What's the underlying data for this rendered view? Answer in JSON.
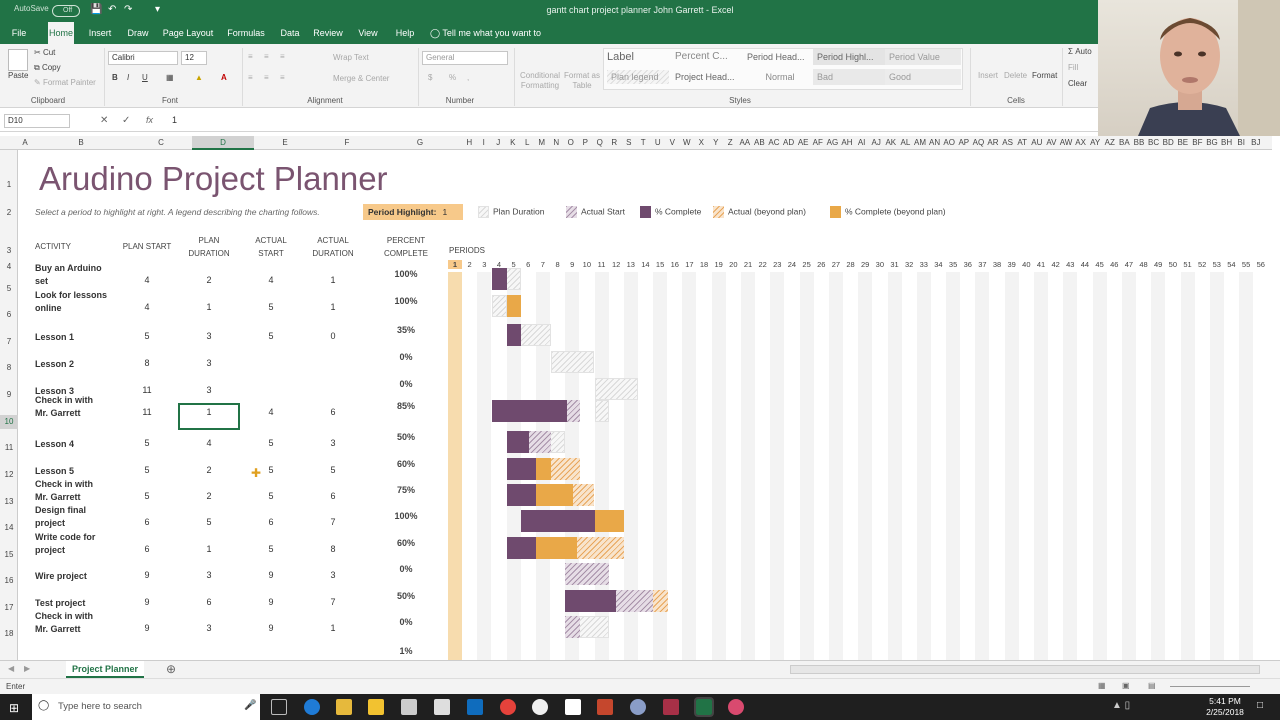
{
  "window": {
    "title": "gantt chart project planner John Garrett - Excel",
    "autosave_label": "AutoSave",
    "autosave_state": "Off"
  },
  "ribbon_tabs": [
    "File",
    "Home",
    "Insert",
    "Draw",
    "Page Layout",
    "Formulas",
    "Data",
    "Review",
    "View",
    "Help"
  ],
  "active_tab": "Home",
  "tell_me": "Tell me what you want to do",
  "ribbon": {
    "cut": "Cut",
    "copy": "Copy",
    "format_painter": "Format Painter",
    "paste": "Paste",
    "font_name": "Calibri",
    "font_size": "12",
    "wrap_text": "Wrap Text",
    "merge_center": "Merge & Center",
    "number_format": "General",
    "conditional_formatting": "Conditional Formatting",
    "format_as_table": "Format as Table",
    "insert": "Insert",
    "delete": "Delete",
    "format": "Format",
    "autosum": "Auto",
    "fill": "Fill",
    "clear": "Clear",
    "groups": {
      "clipboard": "Clipboard",
      "font": "Font",
      "alignment": "Alignment",
      "number": "Number",
      "styles": "Styles",
      "cells": "Cells"
    },
    "styles": [
      "Label",
      "Percent C...",
      "Period Head...",
      "Period Highl...",
      "Period Value",
      "Plan legend",
      "Project Head...",
      "Normal",
      "Bad",
      "Good"
    ]
  },
  "formula_bar": {
    "name_box": "D10",
    "value": "1",
    "fx": "fx"
  },
  "columns": [
    "A",
    "B",
    "C",
    "D",
    "E",
    "F",
    "G",
    "H",
    "I",
    "J",
    "K",
    "L",
    "M",
    "N",
    "O",
    "P",
    "Q",
    "R",
    "S",
    "T",
    "U",
    "V",
    "W",
    "X",
    "Y",
    "Z",
    "AA",
    "AB",
    "AC",
    "AD",
    "AE",
    "AF",
    "AG",
    "AH",
    "AI",
    "AJ",
    "AK",
    "AL",
    "AM",
    "AN",
    "AO",
    "AP",
    "AQ",
    "AR",
    "AS",
    "AT",
    "AU",
    "AV",
    "AW",
    "AX",
    "AY",
    "AZ",
    "BA",
    "BB",
    "BC",
    "BD",
    "BE",
    "BF",
    "BG",
    "BH",
    "BI",
    "BJ"
  ],
  "selected_column": "D",
  "rows": [
    "1",
    "2",
    "3",
    "4",
    "5",
    "6",
    "7",
    "8",
    "9",
    "10",
    "11",
    "12",
    "13",
    "14",
    "15",
    "16",
    "17",
    "18"
  ],
  "selected_row": "10",
  "sheet": {
    "title": "Arudino Project Planner",
    "subtitle": "Select a period to highlight at right.  A legend describing the charting follows.",
    "period_highlight_label": "Period Highlight:",
    "period_highlight_value": "1",
    "legend": [
      "Plan Duration",
      "Actual Start",
      "% Complete",
      "Actual (beyond plan)",
      "% Complete (beyond plan)"
    ],
    "headers": {
      "activity": "ACTIVITY",
      "plan_start": "PLAN START",
      "plan_duration": [
        "PLAN",
        "DURATION"
      ],
      "actual_start": [
        "ACTUAL",
        "START"
      ],
      "actual_duration": [
        "ACTUAL",
        "DURATION"
      ],
      "percent_complete": [
        "PERCENT",
        "COMPLETE"
      ],
      "periods": "PERIODS"
    },
    "periods": [
      "1",
      "2",
      "3",
      "4",
      "5",
      "6",
      "7",
      "8",
      "9",
      "10",
      "11",
      "12",
      "13",
      "14",
      "15",
      "16",
      "17",
      "18",
      "19",
      "20",
      "21",
      "22",
      "23",
      "24",
      "25",
      "26",
      "27",
      "28",
      "29",
      "30",
      "31",
      "32",
      "33",
      "34",
      "35",
      "36",
      "37",
      "38",
      "39",
      "40",
      "41",
      "42",
      "43",
      "44",
      "45",
      "46",
      "47",
      "48",
      "49",
      "50",
      "51",
      "52",
      "53",
      "54",
      "55",
      "56"
    ],
    "activities": [
      {
        "name": [
          "Buy an Arduino",
          "set"
        ],
        "plan_start": "4",
        "plan_duration": "2",
        "actual_start": "4",
        "actual_duration": "1",
        "percent": "100%"
      },
      {
        "name": [
          "Look for lessons",
          "online"
        ],
        "plan_start": "4",
        "plan_duration": "1",
        "actual_start": "5",
        "actual_duration": "1",
        "percent": "100%"
      },
      {
        "name": [
          "Lesson 1"
        ],
        "plan_start": "5",
        "plan_duration": "3",
        "actual_start": "5",
        "actual_duration": "0",
        "percent": "35%"
      },
      {
        "name": [
          "Lesson 2"
        ],
        "plan_start": "8",
        "plan_duration": "3",
        "actual_start": "",
        "actual_duration": "",
        "percent": "0%"
      },
      {
        "name": [
          "Lesson 3"
        ],
        "plan_start": "11",
        "plan_duration": "3",
        "actual_start": "",
        "actual_duration": "",
        "percent": "0%"
      },
      {
        "name": [
          "Check in with",
          "Mr. Garrett"
        ],
        "plan_start": "11",
        "plan_duration": "1",
        "actual_start": "4",
        "actual_duration": "6",
        "percent": "85%"
      },
      {
        "name": [
          "Lesson 4"
        ],
        "plan_start": "5",
        "plan_duration": "4",
        "actual_start": "5",
        "actual_duration": "3",
        "percent": "50%"
      },
      {
        "name": [
          "Lesson 5"
        ],
        "plan_start": "5",
        "plan_duration": "2",
        "actual_start": "5",
        "actual_duration": "5",
        "percent": "60%"
      },
      {
        "name": [
          "Check in with",
          "Mr. Garrett"
        ],
        "plan_start": "5",
        "plan_duration": "2",
        "actual_start": "5",
        "actual_duration": "6",
        "percent": "75%"
      },
      {
        "name": [
          "Design final",
          "project"
        ],
        "plan_start": "6",
        "plan_duration": "5",
        "actual_start": "6",
        "actual_duration": "7",
        "percent": "100%"
      },
      {
        "name": [
          "Write code for",
          "project"
        ],
        "plan_start": "6",
        "plan_duration": "1",
        "actual_start": "5",
        "actual_duration": "8",
        "percent": "60%"
      },
      {
        "name": [
          "Wire project"
        ],
        "plan_start": "9",
        "plan_duration": "3",
        "actual_start": "9",
        "actual_duration": "3",
        "percent": "0%"
      },
      {
        "name": [
          "Test project"
        ],
        "plan_start": "9",
        "plan_duration": "6",
        "actual_start": "9",
        "actual_duration": "7",
        "percent": "50%"
      },
      {
        "name": [
          "Check in with",
          "Mr. Garrett"
        ],
        "plan_start": "9",
        "plan_duration": "3",
        "actual_start": "9",
        "actual_duration": "1",
        "percent": "0%"
      },
      {
        "name": [
          ""
        ],
        "plan_start": "",
        "plan_duration": "",
        "actual_start": "",
        "actual_duration": "",
        "percent": "1%"
      }
    ]
  },
  "sheet_tab": "Project Planner",
  "status": {
    "mode": "Enter"
  },
  "taskbar": {
    "search_placeholder": "Type here to search",
    "time": "5:41 PM",
    "date": "2/25/2018"
  },
  "colors": {
    "excel_green": "#217346",
    "title_plum": "#7a5470",
    "complete_plum": "#6f4a6e",
    "orange": "#e9a848",
    "highlight": "#f7c98a"
  }
}
